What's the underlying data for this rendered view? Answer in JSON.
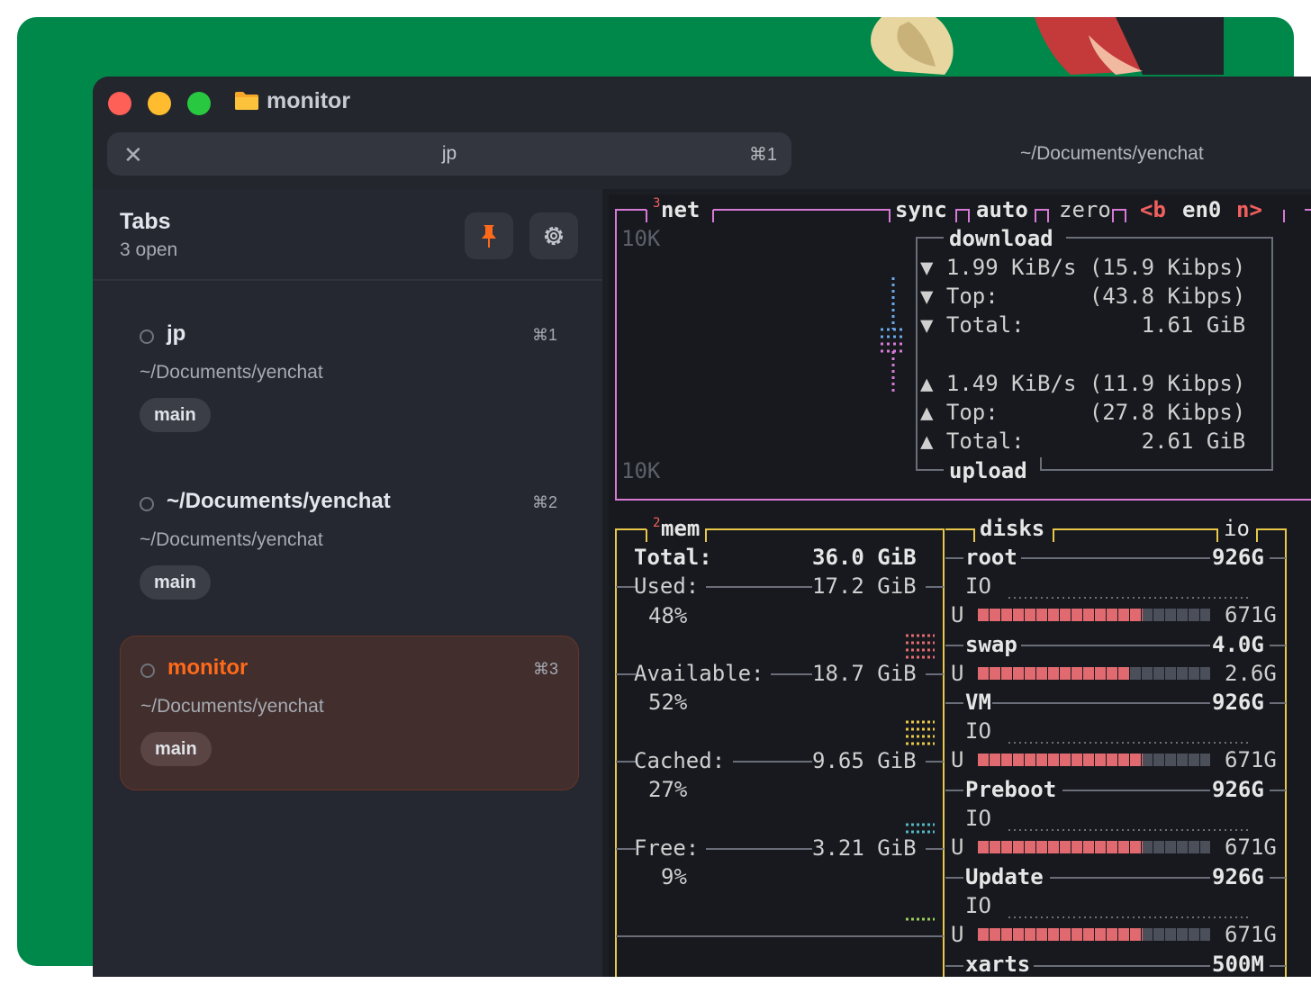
{
  "window": {
    "title": "monitor",
    "folder_icon": "folder-icon"
  },
  "tabbar": {
    "active_tab": {
      "close_icon": "✕",
      "name": "jp",
      "shortcut": "⌘1"
    },
    "other_tab": "~/Documents/yenchat"
  },
  "sidebar": {
    "title": "Tabs",
    "subtitle": "3 open",
    "pin_icon": "pin-icon",
    "settings_icon": "gear-icon",
    "items": [
      {
        "title": "jp",
        "shortcut": "⌘1",
        "path": "~/Documents/yenchat",
        "branch": "main"
      },
      {
        "title": "~/Documents/yenchat",
        "shortcut": "⌘2",
        "path": "~/Documents/yenchat",
        "branch": "main"
      },
      {
        "title": "monitor",
        "shortcut": "⌘3",
        "path": "~/Documents/yenchat",
        "branch": "main",
        "active": true
      }
    ]
  },
  "terminal": {
    "net": {
      "num": "3",
      "title": "net",
      "options": [
        "sync",
        "auto",
        "zero",
        "<b",
        "en0",
        "n>"
      ],
      "scale_top": "10K",
      "scale_bottom": "10K",
      "download_label": "download",
      "dl_rows": [
        "▼ 1.99 KiB/s (15.9 Kibps)",
        "▼ Top:       (43.8 Kibps)",
        "▼ Total:         1.61 GiB"
      ],
      "ul_rows": [
        "▲ 1.49 KiB/s (11.9 Kibps)",
        "▲ Top:       (27.8 Kibps)",
        "▲ Total:         2.61 GiB"
      ],
      "upload_label": "upload"
    },
    "mem": {
      "num": "2",
      "title": "mem",
      "total_label": "Total:",
      "total_value": "36.0 GiB",
      "rows": [
        {
          "label": "Used:",
          "value": "17.2 GiB",
          "pct": "48%"
        },
        {
          "label": "Available:",
          "value": "18.7 GiB",
          "pct": "52%"
        },
        {
          "label": "Cached:",
          "value": "9.65 GiB",
          "pct": "27%"
        },
        {
          "label": "Free:",
          "value": "3.21 GiB",
          "pct": "9%"
        }
      ]
    },
    "disks": {
      "title": "disks",
      "io_title": "io",
      "entries": [
        {
          "name": "root",
          "size": "926G",
          "io_label": "IO",
          "u_label": "U",
          "used": "671G",
          "fill": 0.71
        },
        {
          "name": "swap",
          "size": "4.0G",
          "u_label": "U",
          "used": "2.6G",
          "fill": 0.65
        },
        {
          "name": "VM",
          "size": "926G",
          "io_label": "IO",
          "u_label": "U",
          "used": "671G",
          "fill": 0.71
        },
        {
          "name": "Preboot",
          "size": "926G",
          "io_label": "IO",
          "u_label": "U",
          "used": "671G",
          "fill": 0.71
        },
        {
          "name": "Update",
          "size": "926G",
          "io_label": "IO",
          "u_label": "U",
          "used": "671G",
          "fill": 0.71
        },
        {
          "name": "xarts",
          "size": "500M"
        }
      ]
    }
  },
  "colors": {
    "accent": "#ff6a1a",
    "net_border": "#d67ad6",
    "mem_border": "#e8c84a",
    "bar_used": "#e06a6f",
    "bar_free": "#4a4f5a"
  }
}
